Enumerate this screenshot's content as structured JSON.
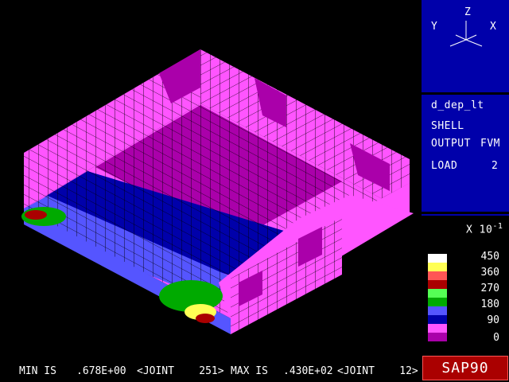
{
  "app": {
    "logo": "SAP90"
  },
  "axes_widget": {
    "x": "X",
    "y": "Y",
    "z": "Z"
  },
  "info": {
    "model_name": "d_dep_lt",
    "element_type": "SHELL",
    "output_line_label": "OUTPUT",
    "output_type": "FVM",
    "load_label": "LOAD",
    "load_number": "2"
  },
  "legend": {
    "scale_prefix": "X 10",
    "scale_exponent": "-1",
    "labels": [
      "450",
      "360",
      "270",
      "180",
      "90",
      "0"
    ],
    "colors": [
      "#ffffff",
      "#ffff55",
      "#ff5555",
      "#aa0000",
      "#55ff55",
      "#00aa00",
      "#5555ff",
      "#0000aa",
      "#ff55ff",
      "#aa00aa"
    ]
  },
  "status": {
    "min_label": "MIN IS",
    "min_value": ".678E+00",
    "min_joint": "<JOINT    251>",
    "max_label": "MAX IS",
    "max_value": ".430E+02",
    "max_joint": "<JOINT    12>"
  }
}
